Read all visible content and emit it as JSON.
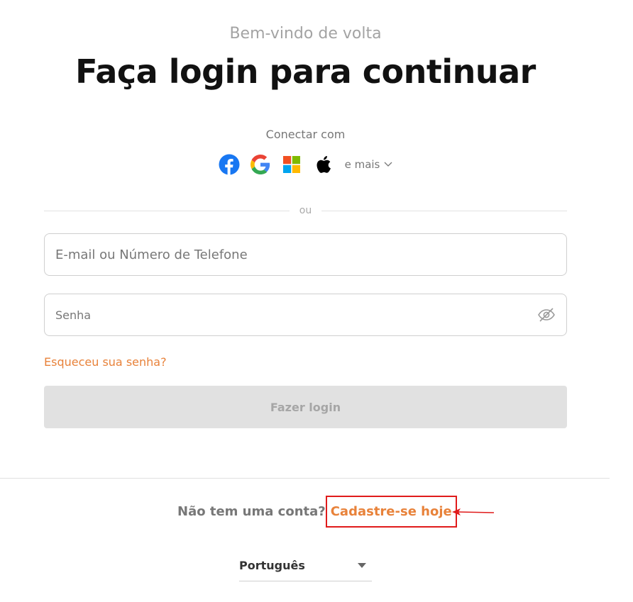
{
  "header": {
    "welcome": "Bem-vindo de volta",
    "title": "Faça login para continuar"
  },
  "social": {
    "label": "Conectar com",
    "providers": [
      {
        "name": "Facebook",
        "icon": "facebook-icon"
      },
      {
        "name": "Google",
        "icon": "google-icon"
      },
      {
        "name": "Microsoft",
        "icon": "microsoft-icon"
      },
      {
        "name": "Apple",
        "icon": "apple-icon"
      }
    ],
    "more_label": "e mais"
  },
  "divider": {
    "text": "ou"
  },
  "form": {
    "email_placeholder": "E-mail ou Número de Telefone",
    "password_placeholder": "Senha",
    "forgot_label": "Esqueceu sua senha?",
    "login_label": "Fazer login"
  },
  "signup": {
    "question": "Não tem uma conta?",
    "link_label": "Cadastre-se hoje"
  },
  "language": {
    "selected": "Português"
  },
  "colors": {
    "accent": "#e8823a",
    "highlight_box": "#e01b1b",
    "button_disabled_bg": "#e1e1e1"
  }
}
